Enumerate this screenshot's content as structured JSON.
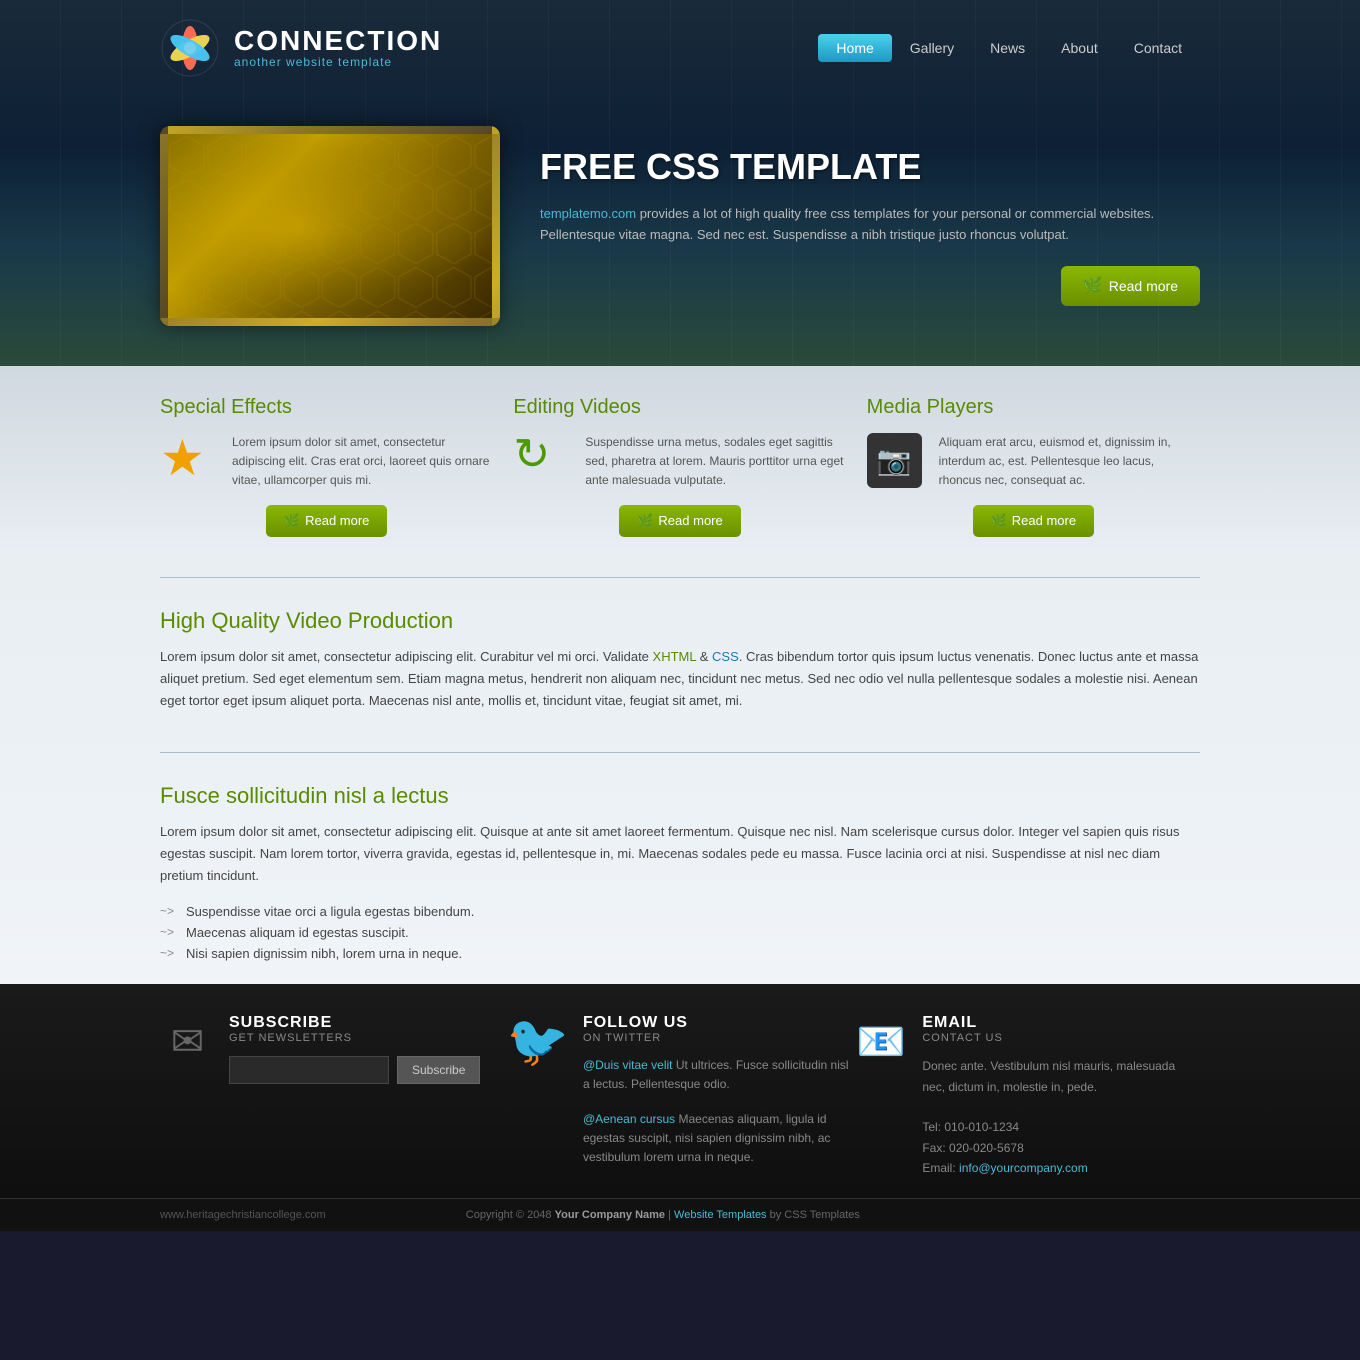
{
  "site": {
    "url": "www.heritagechristiancollege.com",
    "logo_title": "CONNECTION",
    "logo_subtitle": "another website template"
  },
  "nav": {
    "links": [
      {
        "label": "Home",
        "active": true
      },
      {
        "label": "Gallery",
        "active": false
      },
      {
        "label": "News",
        "active": false
      },
      {
        "label": "About",
        "active": false
      },
      {
        "label": "Contact",
        "active": false
      }
    ]
  },
  "hero": {
    "title": "FREE CSS TEMPLATE",
    "link_text": "templatemo.com",
    "text": " provides a lot of high quality free css templates for your personal or commercial websites. Pellentesque vitae magna. Sed nec est. Suspendisse a nibh tristique justo rhoncus volutpat.",
    "read_more": "Read more"
  },
  "features": [
    {
      "title": "Special Effects",
      "icon": "star",
      "text": "Lorem ipsum dolor sit amet, consectetur adipiscing elit. Cras erat orci, laoreet quis ornare vitae, ullamcorper quis mi.",
      "btn": "Read more"
    },
    {
      "title": "Editing Videos",
      "icon": "refresh",
      "text": "Suspendisse urna metus, sodales eget sagittis sed, pharetra at lorem. Mauris porttitor urna eget ante malesuada vulputate.",
      "btn": "Read more"
    },
    {
      "title": "Media Players",
      "icon": "camera",
      "text": "Aliquam erat arcu, euismod et, dignissim in, interdum ac, est. Pellentesque leo lacus, rhoncus nec, consequat ac.",
      "btn": "Read more"
    }
  ],
  "section1": {
    "title": "High Quality Video Production",
    "text": "Lorem ipsum dolor sit amet, consectetur adipiscing elit. Curabitur vel mi orci. Validate ",
    "xhtml_link": "XHTML",
    "mid_text": " & ",
    "css_link": "CSS",
    "rest_text": ". Cras bibendum tortor quis ipsum luctus venenatis. Donec luctus ante et massa aliquet pretium. Sed eget elementum sem. Etiam magna metus, hendrerit non aliquam nec, tincidunt nec metus. Sed nec odio vel nulla pellentesque sodales a molestie nisi. Aenean eget tortor eget ipsum aliquet porta. Maecenas nisl ante, mollis et, tincidunt vitae, feugiat sit amet, mi."
  },
  "section2": {
    "title": "Fusce sollicitudin nisl a lectus",
    "text": "Lorem ipsum dolor sit amet, consectetur adipiscing elit. Quisque at ante sit amet laoreet fermentum. Quisque nec nisl. Nam scelerisque cursus dolor. Integer vel sapien quis risus egestas suscipit. Nam lorem tortor, viverra gravida, egestas id, pellentesque in, mi. Maecenas sodales pede eu massa. Fusce lacinia orci at nisi. Suspendisse at nisl nec diam pretium tincidunt.",
    "list": [
      "Suspendisse vitae orci a ligula egestas bibendum.",
      "Maecenas aliquam id egestas suscipit.",
      "Nisi sapien dignissim nibh, lorem urna in neque."
    ]
  },
  "footer": {
    "subscribe": {
      "title": "SUBSCRIBE",
      "subtitle": "GET NEWSLETTERS",
      "btn": "Subscribe",
      "input_placeholder": ""
    },
    "twitter": {
      "title": "FOLLOW US",
      "subtitle": "ON TWITTER",
      "handle1": "@Duis vitae velit",
      "text1": " Ut ultrices. Fusce sollicitudin nisl a lectus. Pellentesque odio.",
      "handle2": "@Aenean cursus",
      "text2": " Maecenas aliquam, ligula id egestas suscipit, nisi sapien dignissim nibh, ac vestibulum lorem urna in neque."
    },
    "email": {
      "title": "EMAIL",
      "subtitle": "CONTACT US",
      "text": "Donec ante. Vestibulum nisl mauris, malesuada nec, dictum in, molestie in, pede.",
      "tel": "Tel: 010-010-1234",
      "fax": "Fax: 020-020-5678",
      "email_label": "Email: ",
      "email_address": "info@yourcompany.com"
    },
    "copyright": {
      "text": "Copyright © 2048 ",
      "company": "Your Company Name",
      "sep": " | ",
      "link_text": "Website Templates",
      "by": " by CSS Templates"
    }
  }
}
